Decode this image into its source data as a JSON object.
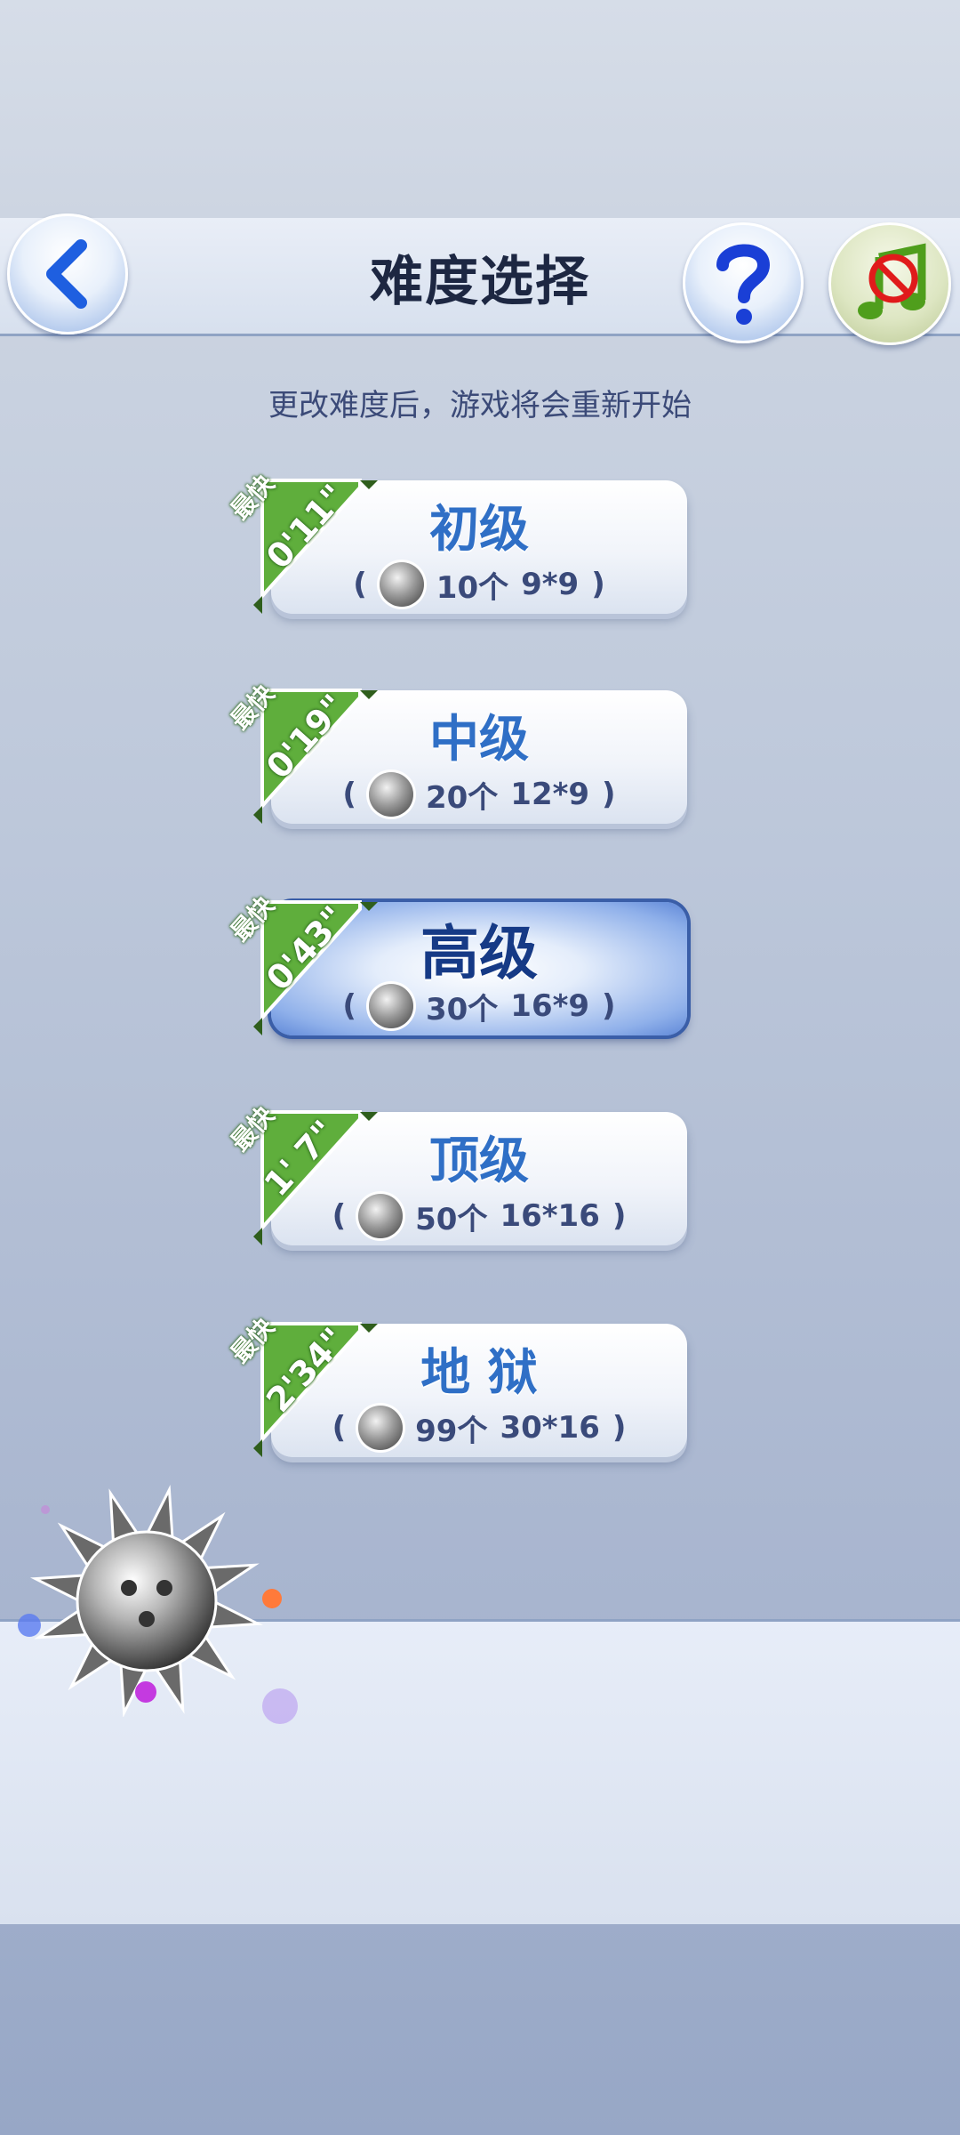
{
  "header": {
    "title": "难度选择"
  },
  "notice": "更改难度后，游戏将会重新开始",
  "levels": [
    {
      "name": "初级",
      "fastest_label": "最快",
      "best_time": "0'11\"",
      "mines": "10个",
      "size": "9*9",
      "open": "(",
      "close": ")",
      "selected": false
    },
    {
      "name": "中级",
      "fastest_label": "最快",
      "best_time": "0'19\"",
      "mines": "20个",
      "size": "12*9",
      "open": "(",
      "close": ")",
      "selected": false
    },
    {
      "name": "高级",
      "fastest_label": "最快",
      "best_time": "0'43\"",
      "mines": "30个",
      "size": "16*9",
      "open": "(",
      "close": ")",
      "selected": true
    },
    {
      "name": "顶级",
      "fastest_label": "最快",
      "best_time": "1' 7\"",
      "mines": "50个",
      "size": "16*16",
      "open": "(",
      "close": ")",
      "selected": false
    },
    {
      "name": "地 狱",
      "fastest_label": "最快",
      "best_time": "2'34\"",
      "mines": "99个",
      "size": "30*16",
      "open": "(",
      "close": ")",
      "selected": false
    }
  ],
  "icons": {
    "back": "back-arrow-icon",
    "help": "question-icon",
    "music": "music-muted-icon",
    "mine": "mine-icon"
  },
  "colors": {
    "title": "#1d2742",
    "level_text": "#2f6fc6",
    "ribbon": "#5fae3c",
    "selected_border": "#3a5ea8"
  }
}
